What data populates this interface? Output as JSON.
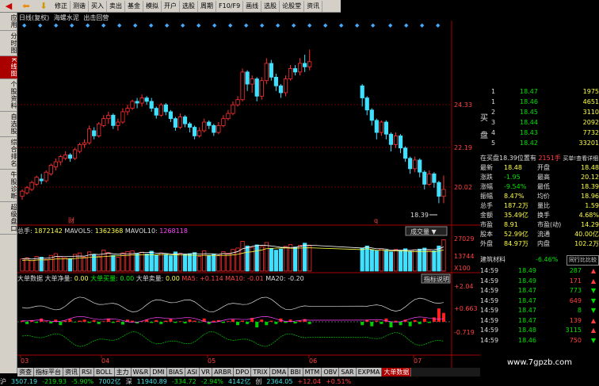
{
  "toolbar": {
    "buttons": [
      "修正",
      "测谐",
      "买入",
      "卖出",
      "基金",
      "模拟",
      "开户",
      "选股",
      "周期",
      "F10/F9",
      "画线",
      "选股",
      "论股堂",
      "资讯"
    ]
  },
  "leftbar": {
    "tabs": [
      "应用",
      "分时图",
      "K线图",
      "个股资料",
      "自选股",
      "综合排名",
      "牛股诊断",
      "超级盘口"
    ],
    "active": 2
  },
  "title": {
    "period": "日线(复权)",
    "stock": "海螺水泥",
    "status": "出击回营"
  },
  "kline": {
    "price_labels": [
      "24.33",
      "22.19",
      "20.02"
    ],
    "low_label": "18.39",
    "markers": [
      "财",
      "q"
    ],
    "bars": [
      [
        18.8,
        19.1,
        18.6,
        19.2
      ],
      [
        19.0,
        19.3,
        18.9,
        19.4
      ],
      [
        19.2,
        19.6,
        19.1,
        19.7
      ],
      [
        19.5,
        19.9,
        19.4,
        20.0
      ],
      [
        19.8,
        19.7,
        19.5,
        20.1
      ],
      [
        19.7,
        20.2,
        19.6,
        20.3
      ],
      [
        20.1,
        20.6,
        20.0,
        20.7
      ],
      [
        20.5,
        20.8,
        20.3,
        21.0
      ],
      [
        20.8,
        21.1,
        20.6,
        21.2
      ],
      [
        21.0,
        21.2,
        20.9,
        21.4
      ],
      [
        21.2,
        21.0,
        20.8,
        21.3
      ],
      [
        21.0,
        21.5,
        20.9,
        21.6
      ],
      [
        21.4,
        21.8,
        21.3,
        21.9
      ],
      [
        21.8,
        21.9,
        21.6,
        22.1
      ],
      [
        21.9,
        22.7,
        21.8,
        22.9
      ],
      [
        22.6,
        22.3,
        22.1,
        22.8
      ],
      [
        22.3,
        23.0,
        22.2,
        23.1
      ],
      [
        22.9,
        23.3,
        22.8,
        23.5
      ],
      [
        23.3,
        23.5,
        23.0,
        23.7
      ],
      [
        23.5,
        22.9,
        22.7,
        23.6
      ],
      [
        22.9,
        23.1,
        22.6,
        23.3
      ],
      [
        23.1,
        23.7,
        23.0,
        23.9
      ],
      [
        23.7,
        23.9,
        23.5,
        24.1
      ],
      [
        23.9,
        24.3,
        23.8,
        24.4
      ],
      [
        24.3,
        24.2,
        23.9,
        24.5
      ],
      [
        24.2,
        24.5,
        24.0,
        24.7
      ],
      [
        24.5,
        24.3,
        24.1,
        24.6
      ],
      [
        24.3,
        23.9,
        23.7,
        24.5
      ],
      [
        23.9,
        23.5,
        23.3,
        24.0
      ],
      [
        23.5,
        24.1,
        23.4,
        24.2
      ],
      [
        24.1,
        23.7,
        23.5,
        24.2
      ],
      [
        23.7,
        23.3,
        23.1,
        23.8
      ],
      [
        23.3,
        22.8,
        22.6,
        23.4
      ],
      [
        22.8,
        23.4,
        22.7,
        23.6
      ],
      [
        23.4,
        23.0,
        22.8,
        23.5
      ],
      [
        23.0,
        22.8,
        22.5,
        23.1
      ],
      [
        22.8,
        22.3,
        22.1,
        22.9
      ],
      [
        22.3,
        22.6,
        22.2,
        22.8
      ],
      [
        22.6,
        23.1,
        22.5,
        23.3
      ],
      [
        23.1,
        22.9,
        22.7,
        23.2
      ],
      [
        22.9,
        22.5,
        22.3,
        23.0
      ],
      [
        22.5,
        22.9,
        22.4,
        23.1
      ],
      [
        22.9,
        23.3,
        22.8,
        23.5
      ],
      [
        23.3,
        23.6,
        23.2,
        23.8
      ],
      [
        23.6,
        24.1,
        23.5,
        24.3
      ],
      [
        24.1,
        24.4,
        24.0,
        24.6
      ],
      [
        24.4,
        26.0,
        24.3,
        26.2
      ],
      [
        26.0,
        25.3,
        24.9,
        26.1
      ],
      [
        25.3,
        25.6,
        24.8,
        25.8
      ],
      [
        25.6,
        24.6,
        24.3,
        25.7
      ],
      [
        24.6,
        25.5,
        24.4,
        25.7
      ],
      [
        25.5,
        26.5,
        25.3,
        26.8
      ],
      [
        26.5,
        25.7,
        25.5,
        26.7
      ],
      [
        25.7,
        25.2,
        24.9,
        25.9
      ],
      [
        25.2,
        24.8,
        24.5,
        25.3
      ],
      [
        24.8,
        25.6,
        24.6,
        25.8
      ],
      [
        25.6,
        26.2,
        25.5,
        26.4
      ],
      [
        26.2,
        26.0,
        25.8,
        26.4
      ],
      [
        26.0,
        26.5,
        25.8,
        26.8
      ],
      [
        26.5,
        26.3,
        26.0,
        27.0
      ],
      [
        26.3,
        26.6,
        26.1,
        27.3
      ],
      null,
      null,
      null,
      null,
      null,
      null,
      null,
      null,
      null,
      null,
      [
        25.2,
        24.5,
        24.0,
        25.3
      ],
      [
        24.5,
        23.8,
        23.5,
        24.6
      ],
      [
        23.8,
        23.2,
        22.9,
        23.9
      ],
      [
        23.2,
        22.5,
        22.1,
        23.3
      ],
      [
        22.5,
        23.1,
        22.3,
        23.2
      ],
      [
        23.1,
        22.4,
        22.1,
        23.2
      ],
      [
        22.4,
        21.8,
        21.4,
        22.5
      ],
      [
        21.8,
        22.3,
        21.6,
        22.5
      ],
      [
        22.3,
        21.6,
        21.3,
        22.4
      ],
      [
        21.6,
        21.0,
        20.8,
        21.7
      ],
      [
        21.0,
        20.4,
        20.1,
        21.1
      ],
      [
        20.4,
        20.9,
        20.2,
        21.1
      ],
      [
        20.9,
        20.2,
        19.9,
        21.0
      ],
      [
        20.2,
        19.5,
        19.2,
        20.3
      ],
      [
        19.5,
        20.1,
        19.4,
        20.3
      ],
      [
        20.1,
        19.6,
        19.3,
        20.2
      ],
      [
        19.6,
        18.8,
        18.4,
        19.7
      ],
      [
        18.8,
        19.2,
        18.4,
        20.0
      ]
    ]
  },
  "volume": {
    "label": "总手",
    "value": "1872142",
    "mavol5_label": "MAVOL5",
    "mavol5": "1362368",
    "mavol10_label": "MAVOL10",
    "mavol10": "1268118",
    "dropdown": "成交量",
    "axis": [
      "27029",
      "13744",
      "X100"
    ],
    "bars": [
      0.35,
      0.38,
      0.3,
      0.42,
      0.4,
      0.33,
      0.45,
      0.5,
      0.41,
      0.38,
      0.36,
      0.48,
      0.52,
      0.4,
      0.55,
      0.47,
      0.43,
      0.6,
      0.53,
      0.45,
      0.4,
      0.52,
      0.56,
      0.58,
      0.5,
      0.54,
      0.49,
      0.57,
      0.46,
      0.52,
      0.48,
      0.44,
      0.55,
      0.51,
      0.47,
      0.5,
      0.53,
      0.42,
      0.58,
      0.45,
      0.49,
      0.44,
      0.56,
      0.51,
      0.62,
      0.66,
      0.85,
      0.72,
      0.68,
      0.75,
      0.7,
      0.82,
      0.65,
      0.6,
      0.63,
      0.71,
      0.76,
      0.69,
      0.74,
      0.8,
      0.73,
      null,
      null,
      null,
      null,
      null,
      null,
      null,
      null,
      null,
      null,
      0.66,
      0.72,
      0.61,
      0.58,
      0.64,
      0.6,
      0.55,
      0.62,
      0.59,
      0.64,
      0.57,
      0.61,
      0.63,
      0.66,
      0.6,
      0.58,
      0.72,
      0.9
    ]
  },
  "dde": {
    "name": "大单数据",
    "net_label": "大单净量:",
    "net": "0.00",
    "buy_label": "大单买量:",
    "buy": "0.00",
    "sell_label": "大单卖量:",
    "sell": "0.00",
    "ma5": "MA5: +0.114",
    "ma10": "MA10: -0.01",
    "ma20": "MA20: -0.20",
    "btn": "指标说明",
    "axis": [
      "+2.04",
      "+0.663",
      "-0.719"
    ],
    "bars": [
      0.1,
      -0.2,
      0.15,
      -0.1,
      0.3,
      0.05,
      -0.15,
      0.2,
      -0.3,
      0.1,
      0.25,
      -0.05,
      0.1,
      0.2,
      -0.1,
      0.15,
      -0.2,
      0.05,
      0.3,
      -0.1,
      0.1,
      -0.25,
      0.2,
      0.1,
      -0.15,
      0.05,
      0.2,
      -0.1,
      0.15,
      -0.2,
      0.1,
      0.25,
      -0.1,
      0.05,
      -0.15,
      0.2,
      0.1,
      -0.05,
      0.3,
      -0.2,
      0.1,
      0.15,
      -0.1,
      0.05,
      0.2,
      -0.3,
      0.1,
      -0.2,
      0.35,
      -0.5,
      0.2,
      -0.3,
      0.1,
      -0.2,
      0.3,
      -0.1,
      0.2,
      -0.15,
      0.1,
      0.25,
      -0.2,
      null,
      null,
      null,
      null,
      null,
      null,
      null,
      null,
      null,
      null,
      -0.3,
      0.2,
      -0.4,
      0.1,
      -0.2,
      0.3,
      -0.5,
      0.1,
      -0.3,
      0.2,
      -0.4,
      0.15,
      -0.2,
      0.3,
      -0.1,
      0.4,
      1.2,
      0.8
    ]
  },
  "xaxis": [
    "03",
    "04",
    "05",
    "06",
    "07"
  ],
  "bottom_tabs": [
    "资查",
    "指标平台",
    "资讯",
    "RSI",
    "BOLL",
    "主力",
    "W&R",
    "DMI",
    "BIAS",
    "ASI",
    "VR",
    "ARBR",
    "DPO",
    "TRIX",
    "DMA",
    "BBI",
    "MTM",
    "OBV",
    "SAR",
    "EXPMA",
    "大单数据"
  ],
  "status": [
    "沪",
    "3507.19",
    "-219.93",
    "-5.90%",
    "7002亿",
    "深",
    "11940.89",
    "-334.72",
    "-2.94%",
    "4142亿",
    "创",
    "2364.05",
    "+12.04",
    "+0.51%"
  ],
  "quote": {
    "asks": [
      [
        "1",
        "18.47",
        "1975"
      ],
      [
        "1",
        "18.46",
        "4651"
      ],
      [
        "2",
        "18.45",
        "3110"
      ],
      [
        "3",
        "18.44",
        "2092"
      ],
      [
        "4",
        "18.43",
        "7732"
      ],
      [
        "5",
        "18.42",
        "33201"
      ]
    ],
    "buy_label": "买",
    "pan_label": "盘",
    "note": "在买盘18.39位置有",
    "note_val": "2151手",
    "note_btn": "买单!查看详细",
    "stats": [
      [
        "最新",
        "18.48",
        "开盘",
        "18.48"
      ],
      [
        "涨跌",
        "-1.95",
        "最高",
        "20.12"
      ],
      [
        "涨幅",
        "-9.54%",
        "最低",
        "18.39"
      ],
      [
        "振幅",
        "8.47%",
        "均价",
        "18.96"
      ],
      [
        "总手",
        "187.2万",
        "量比",
        "1.59"
      ],
      [
        "金额",
        "35.49亿",
        "换手",
        "4.68%"
      ],
      [
        "市盈",
        "8.91",
        "市盈(动)",
        "14.29"
      ],
      [
        "股本",
        "52.99亿",
        "流通",
        "40.00亿"
      ],
      [
        "外盘",
        "84.97万",
        "内盘",
        "102.2万"
      ]
    ],
    "sector": "建筑材料",
    "sector_chg": "-6.46%",
    "sector_btn": "同行比比较",
    "ticks": [
      [
        "14:59",
        "18.49",
        "287"
      ],
      [
        "14:59",
        "18.49",
        "171"
      ],
      [
        "14:59",
        "18.47",
        "773"
      ],
      [
        "14:59",
        "18.47",
        "649"
      ],
      [
        "14:59",
        "18.47",
        "8"
      ],
      [
        "14:59",
        "18.47",
        "139"
      ],
      [
        "14:59",
        "18.48",
        "3115"
      ],
      [
        "14:59",
        "18.46",
        "750"
      ]
    ]
  },
  "watermark": "www.7gpzb.com"
}
